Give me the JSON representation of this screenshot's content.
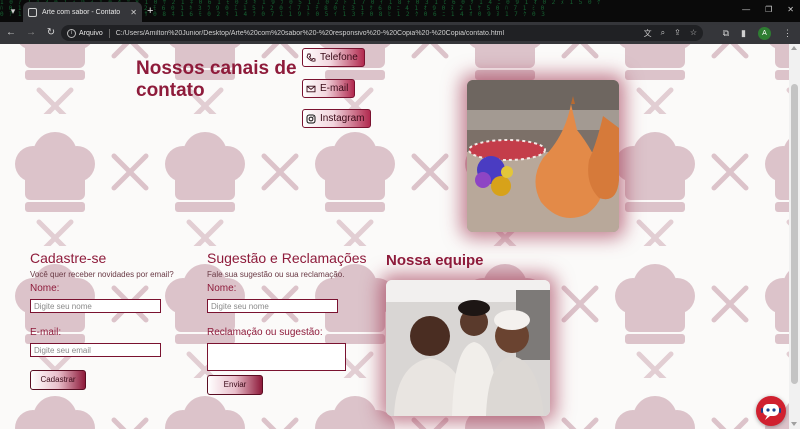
{
  "browser": {
    "tab_title": "Arte com sabor - Contato",
    "omnibox_label": "Arquivo",
    "url": "C:/Users/Amilton%20Junior/Desktop/Arte%20com%20sabor%20-%20responsivo%20-%20Copia%20-%20Copia/contato.html",
    "avatar_letter": "A"
  },
  "contact": {
    "title": "Nossos canais de contato",
    "buttons": [
      {
        "label": "Telefone",
        "icon": "phone-icon"
      },
      {
        "label": "E-mail",
        "icon": "envelope-icon"
      },
      {
        "label": "Instagram",
        "icon": "instagram-icon"
      }
    ]
  },
  "signup": {
    "title": "Cadastre-se",
    "subtitle": "Você quer receber novidades por email?",
    "name_label": "Nome:",
    "name_placeholder": "Digite seu nome",
    "email_label": "E-mail:",
    "email_placeholder": "Digite seu email",
    "submit_label": "Cadastrar"
  },
  "feedback": {
    "title": "Sugestão e Reclamações",
    "subtitle": "Fale sua sugestão ou sua reclamação.",
    "name_label": "Nome:",
    "name_placeholder": "Digite seu nome",
    "message_label": "Reclamação ou sugestão:",
    "submit_label": "Enviar"
  },
  "team": {
    "title": "Nossa equipe"
  },
  "colors": {
    "brand": "#8e1b3b",
    "pattern": "#d9b9c2",
    "chat": "#d0202f"
  }
}
